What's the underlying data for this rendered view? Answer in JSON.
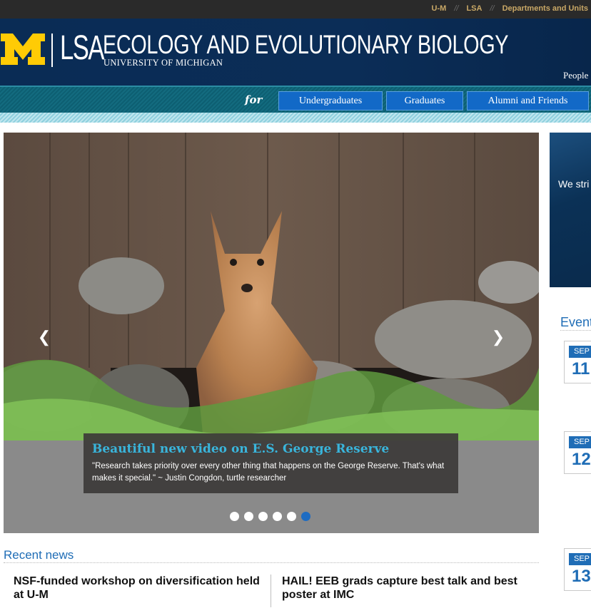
{
  "utility_nav": {
    "items": [
      "U-M",
      "LSA",
      "Departments and Units"
    ],
    "separator": "//"
  },
  "header": {
    "lsa": "LSA",
    "department": "ECOLOGY AND EVOLUTIONARY BIOLOGY",
    "university": "UNIVERSITY OF MICHIGAN",
    "nav_peek": "People"
  },
  "audience_nav": {
    "for_label": "for",
    "buttons": [
      "Undergraduates",
      "Graduates",
      "Alumni and Friends"
    ]
  },
  "carousel": {
    "caption_title": "Beautiful new video on E.S. George Reserve",
    "caption_text": "\"Research takes priority over every other thing that happens on the George Reserve. That's what makes it special.\" ~ Justin Congdon, turtle researcher",
    "slide_count": 6,
    "active_slide": 6,
    "prev_icon": "chevron-left-icon",
    "next_icon": "chevron-right-icon"
  },
  "recent_news": {
    "title": "Recent news",
    "items": [
      "NSF-funded workshop on diversification held at U-M",
      "HAIL! EEB grads capture best talk and best poster at IMC"
    ]
  },
  "mission": {
    "text": "We stri frontlin planet, needs y"
  },
  "events": {
    "title": "Event",
    "items": [
      {
        "month": "SEP",
        "day": "11"
      },
      {
        "month": "SEP",
        "day": "12"
      },
      {
        "month": "SEP",
        "day": "13"
      }
    ]
  },
  "colors": {
    "maize": "#ffcb05",
    "blue": "#0b2d57",
    "link_blue": "#1f6db6",
    "caption_title": "#39b5dc"
  }
}
